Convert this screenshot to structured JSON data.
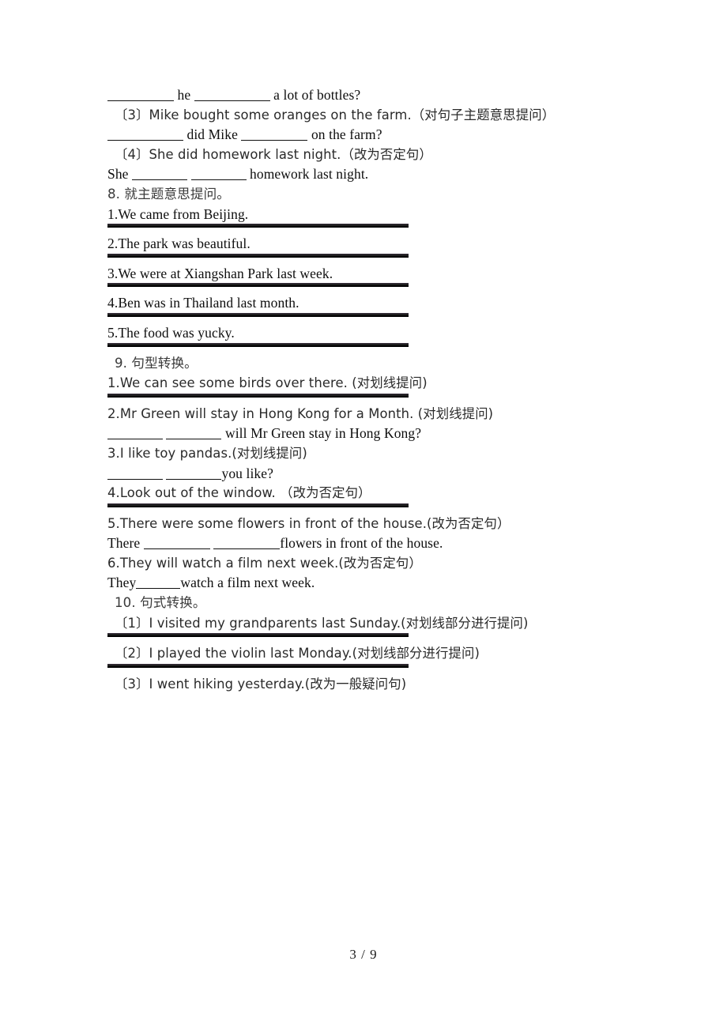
{
  "document": {
    "page_footer": "3 / 9",
    "type": "worksheet"
  },
  "carryover": {
    "q2_answer_prefix": "",
    "q2_answer_mid": "he",
    "q2_answer_suffix": "a lot of bottles?",
    "q3_prompt": "〔3〕Mike bought some oranges on the farm.（对句子主题意思提问）",
    "q3_answer_mid": "did Mike",
    "q3_answer_suffix": "on the farm?",
    "q4_prompt": "〔4〕She did homework last night.（改为否定句）",
    "q4_answer_prefix": "She",
    "q4_answer_suffix": "homework last night."
  },
  "section8": {
    "heading": "8. 就主题意思提问。",
    "items": [
      "1.We came from Beijing.",
      "2.The park was beautiful.",
      "3.We were at Xiangshan Park last week.",
      "4.Ben was in Thailand last month.",
      "5.The food was yucky."
    ]
  },
  "section9": {
    "heading": "9. 句型转换。",
    "item1": "1.We can see some birds over there. (对划线提问)",
    "item2": "2.Mr Green will stay in Hong Kong for a Month. (对划线提问)",
    "item2_answer_suffix": "will Mr Green stay in Hong Kong?",
    "item3": "3.I like toy pandas.(对划线提问)",
    "item3_answer_suffix": "you like?",
    "item4": "4.Look out of the window. （改为否定句）",
    "item5": "5.There were some flowers in front of the house.(改为否定句）",
    "item5_answer_prefix": "There",
    "item5_answer_suffix": "flowers in front of the house.",
    "item6": "6.They will watch a film next week.(改为否定句）",
    "item6_answer_prefix": "They",
    "item6_answer_suffix": "watch a film next week."
  },
  "section10": {
    "heading": "10. 句式转换。",
    "item1": "〔1〕I visited my grandparents last Sunday.(对划线部分进行提问)",
    "item2": "〔2〕I played the violin last Monday.(对划线部分进行提问)",
    "item3": "〔3〕I went hiking yesterday.(改为一般疑问句)"
  }
}
